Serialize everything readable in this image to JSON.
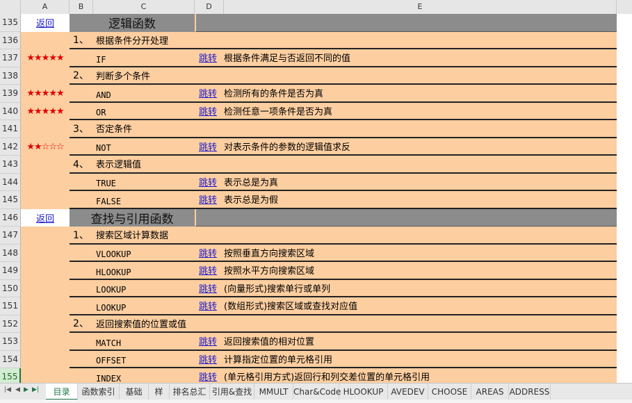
{
  "columns": [
    "A",
    "B",
    "C",
    "D",
    "E"
  ],
  "rows": [
    {
      "n": "135",
      "type": "header",
      "back": "返回",
      "title": "逻辑函数"
    },
    {
      "n": "136",
      "type": "section",
      "num": "1、",
      "text": "根据条件分开处理"
    },
    {
      "n": "137",
      "type": "func",
      "stars": "★★★★★",
      "fn": "IF",
      "jump": "跳转",
      "desc": "根据条件满足与否返回不同的值"
    },
    {
      "n": "138",
      "type": "section",
      "num": "2、",
      "text": "判断多个条件"
    },
    {
      "n": "139",
      "type": "func",
      "stars": "★★★★★",
      "fn": "AND",
      "jump": "跳转",
      "desc": "检测所有的条件是否为真"
    },
    {
      "n": "140",
      "type": "func",
      "stars": "★★★★★",
      "fn": "OR",
      "jump": "跳转",
      "desc": "检测任意一项条件是否为真"
    },
    {
      "n": "141",
      "type": "section",
      "num": "3、",
      "text": "否定条件"
    },
    {
      "n": "142",
      "type": "func",
      "stars": "★★☆☆☆",
      "fn": "NOT",
      "jump": "跳转",
      "desc": "对表示条件的参数的逻辑值求反"
    },
    {
      "n": "143",
      "type": "section",
      "num": "4、",
      "text": "表示逻辑值"
    },
    {
      "n": "144",
      "type": "func",
      "stars": "",
      "fn": "TRUE",
      "jump": "跳转",
      "desc": "表示总是为真"
    },
    {
      "n": "145",
      "type": "func",
      "stars": "",
      "fn": "FALSE",
      "jump": "跳转",
      "desc": "表示总是为假"
    },
    {
      "n": "146",
      "type": "header",
      "back": "返回",
      "title": "查找与引用函数"
    },
    {
      "n": "147",
      "type": "section",
      "num": "1、",
      "text": "搜索区域计算数据"
    },
    {
      "n": "148",
      "type": "func",
      "stars": "",
      "fn": "VLOOKUP",
      "jump": "跳转",
      "desc": "按照垂直方向搜索区域"
    },
    {
      "n": "149",
      "type": "func",
      "stars": "",
      "fn": "HLOOKUP",
      "jump": "跳转",
      "desc": "按照水平方向搜索区域"
    },
    {
      "n": "150",
      "type": "func",
      "stars": "",
      "fn": "LOOKUP",
      "jump": "跳转",
      "desc": "(向量形式)搜索单行或单列"
    },
    {
      "n": "151",
      "type": "func",
      "stars": "",
      "fn": "LOOKUP",
      "jump": "跳转",
      "desc": "(数组形式)搜索区域或查找对应值"
    },
    {
      "n": "152",
      "type": "section",
      "num": "2、",
      "text": "返回搜索值的位置或值"
    },
    {
      "n": "153",
      "type": "func",
      "stars": "",
      "fn": "MATCH",
      "jump": "跳转",
      "desc": "返回搜索值的相对位置"
    },
    {
      "n": "154",
      "type": "func",
      "stars": "",
      "fn": "OFFSET",
      "jump": "跳转",
      "desc": "计算指定位置的单元格引用"
    },
    {
      "n": "155",
      "type": "func",
      "stars": "",
      "fn": "INDEX",
      "jump": "跳转",
      "desc": "(单元格引用方式)返回行和列交差位置的单元格引用",
      "selected": true
    }
  ],
  "tabs": [
    "目录",
    "函数索引",
    "基础",
    "样",
    "排名总汇",
    "引用&查找",
    "MMULT",
    "Char&Code",
    "HLOOKUP",
    "AVEDEV",
    "CHOOSE",
    "AREAS",
    "ADDRESS"
  ],
  "active_tab": "目录",
  "colors": {
    "cell_fill": "#fdcea0",
    "header_band": "#8c8c8c",
    "link": "#1a1acc",
    "star": "#e00000",
    "active_tab": "#217346"
  }
}
